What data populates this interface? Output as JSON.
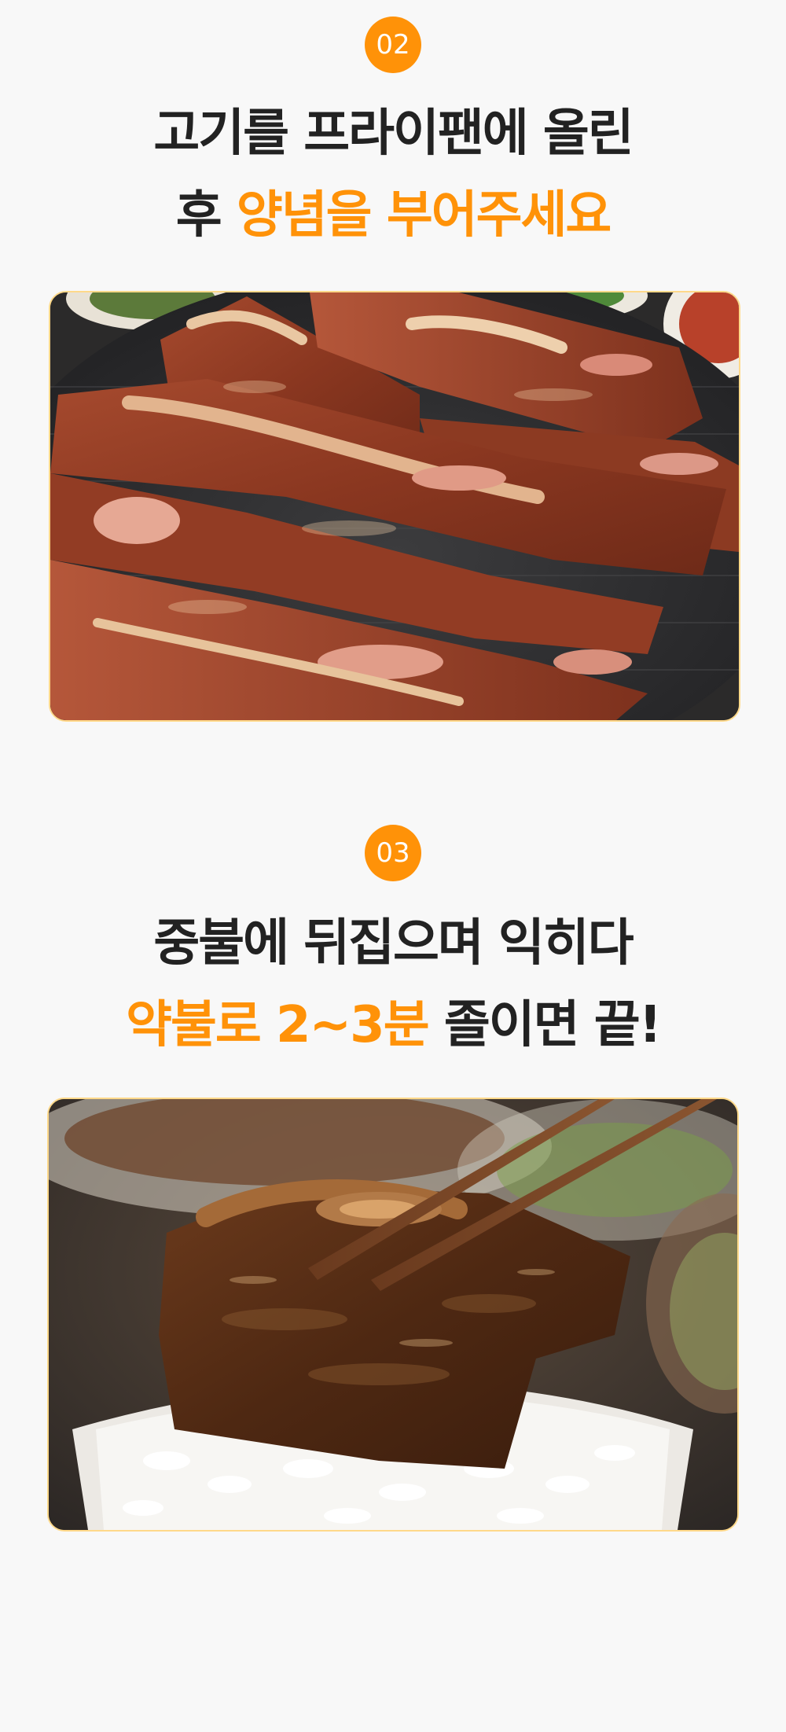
{
  "steps": [
    {
      "number": "02",
      "line1": "고기를 프라이팬에 올린",
      "line2_plain": "후 ",
      "line2_accent": "양념을 부어주세요",
      "image_alt": "marinated beef short ribs (LA galbi) on a round black grill pan"
    },
    {
      "number": "03",
      "line1": "중불에 뒤집으며 익히다",
      "line2_accent": "약불로 2~3분",
      "line2_plain": " 졸이면 끝!",
      "image_alt": "cooked galbi held with wooden chopsticks over a bowl of white rice"
    }
  ],
  "colors": {
    "accent": "#ff9208",
    "frame_border": "#ffd98a",
    "background": "#f8f8f8",
    "heading": "#222222"
  }
}
